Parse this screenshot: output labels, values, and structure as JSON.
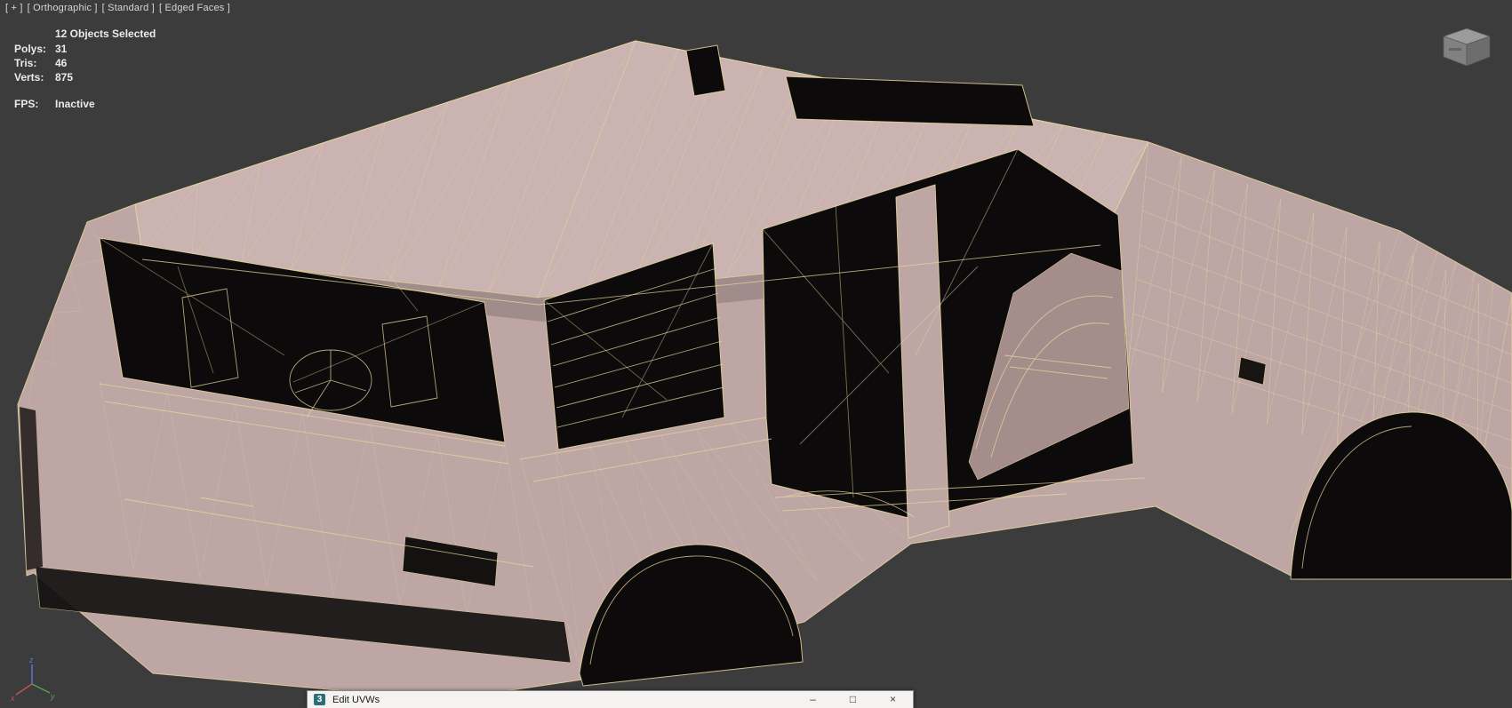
{
  "viewport": {
    "label_segments": [
      {
        "label": "[ + ]"
      },
      {
        "label": "[ Orthographic ]"
      },
      {
        "label": "[ Standard ]"
      },
      {
        "label": "[ Edged Faces ]"
      }
    ],
    "stats": {
      "selection": "12 Objects Selected",
      "rows": [
        {
          "label": "Polys:",
          "value": "31"
        },
        {
          "label": "Tris:",
          "value": "46"
        },
        {
          "label": "Verts:",
          "value": "875"
        }
      ],
      "fps_label": "FPS:",
      "fps_value": "Inactive"
    },
    "axis_gizmo": {
      "x_label": "x",
      "y_label": "y",
      "z_label": "z"
    }
  },
  "floating_window": {
    "title": "Edit UVWs",
    "app_icon_glyph": "3",
    "controls": [
      {
        "name": "minimize",
        "glyph": "–"
      },
      {
        "name": "maximize",
        "glyph": "□"
      },
      {
        "name": "close",
        "glyph": "×"
      }
    ]
  },
  "colors": {
    "viewport_bg": "#3c3c3c",
    "body": "#bda6a4",
    "body_light": "#cab3b0",
    "body_dark": "#a58d8c",
    "wireframe": "#e9d89e",
    "opening": "#0c0a0a"
  }
}
